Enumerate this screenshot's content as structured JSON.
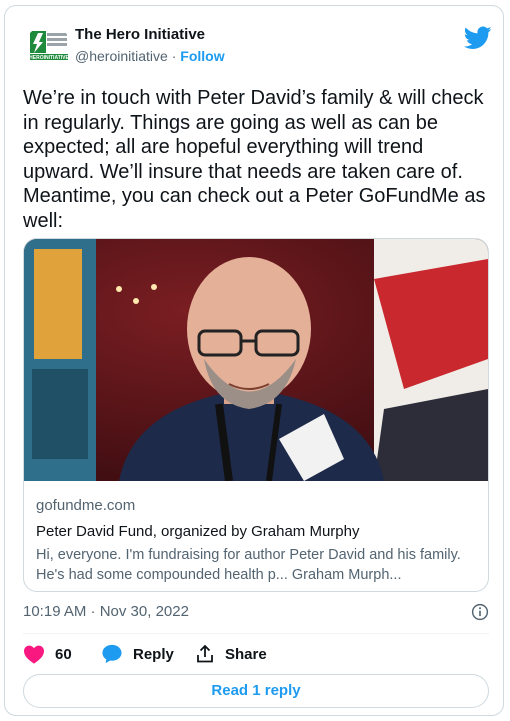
{
  "author": {
    "name": "The Hero Initiative",
    "handle": "@heroinitiative",
    "separator": "·",
    "follow_label": "Follow",
    "avatar_icon": "hero-initiative-logo",
    "avatar_text": "HEROINITIATIVE"
  },
  "tweet": {
    "text": "We’re in touch with Peter David’s family & will check\nin regularly. Things are going as well as can be\nexpected; all are hopeful everything will trend\nupward. We’ll insure that needs are taken care of.\nMeantime, you can check out a Peter GoFundMe as\nwell:"
  },
  "link_card": {
    "domain": "gofundme.com",
    "title": "Peter David Fund, organized by Graham Murphy",
    "description": "Hi, everyone. I'm fundraising for author Peter David and his family. He's had some compounded health p... Graham Murph..."
  },
  "timestamp": "10:19 AM · Nov 30, 2022",
  "actions": {
    "like_count": "60",
    "reply_label": "Reply",
    "share_label": "Share",
    "read_replies_label": "Read 1 reply"
  },
  "colors": {
    "accent": "#1d9bf0",
    "like": "#f91880",
    "text": "#0f1419",
    "muted": "#536471",
    "brand_green": "#1e8a3c"
  },
  "icons": [
    "twitter-bird-icon",
    "info-icon",
    "heart-icon",
    "reply-bubble-icon",
    "share-icon"
  ]
}
